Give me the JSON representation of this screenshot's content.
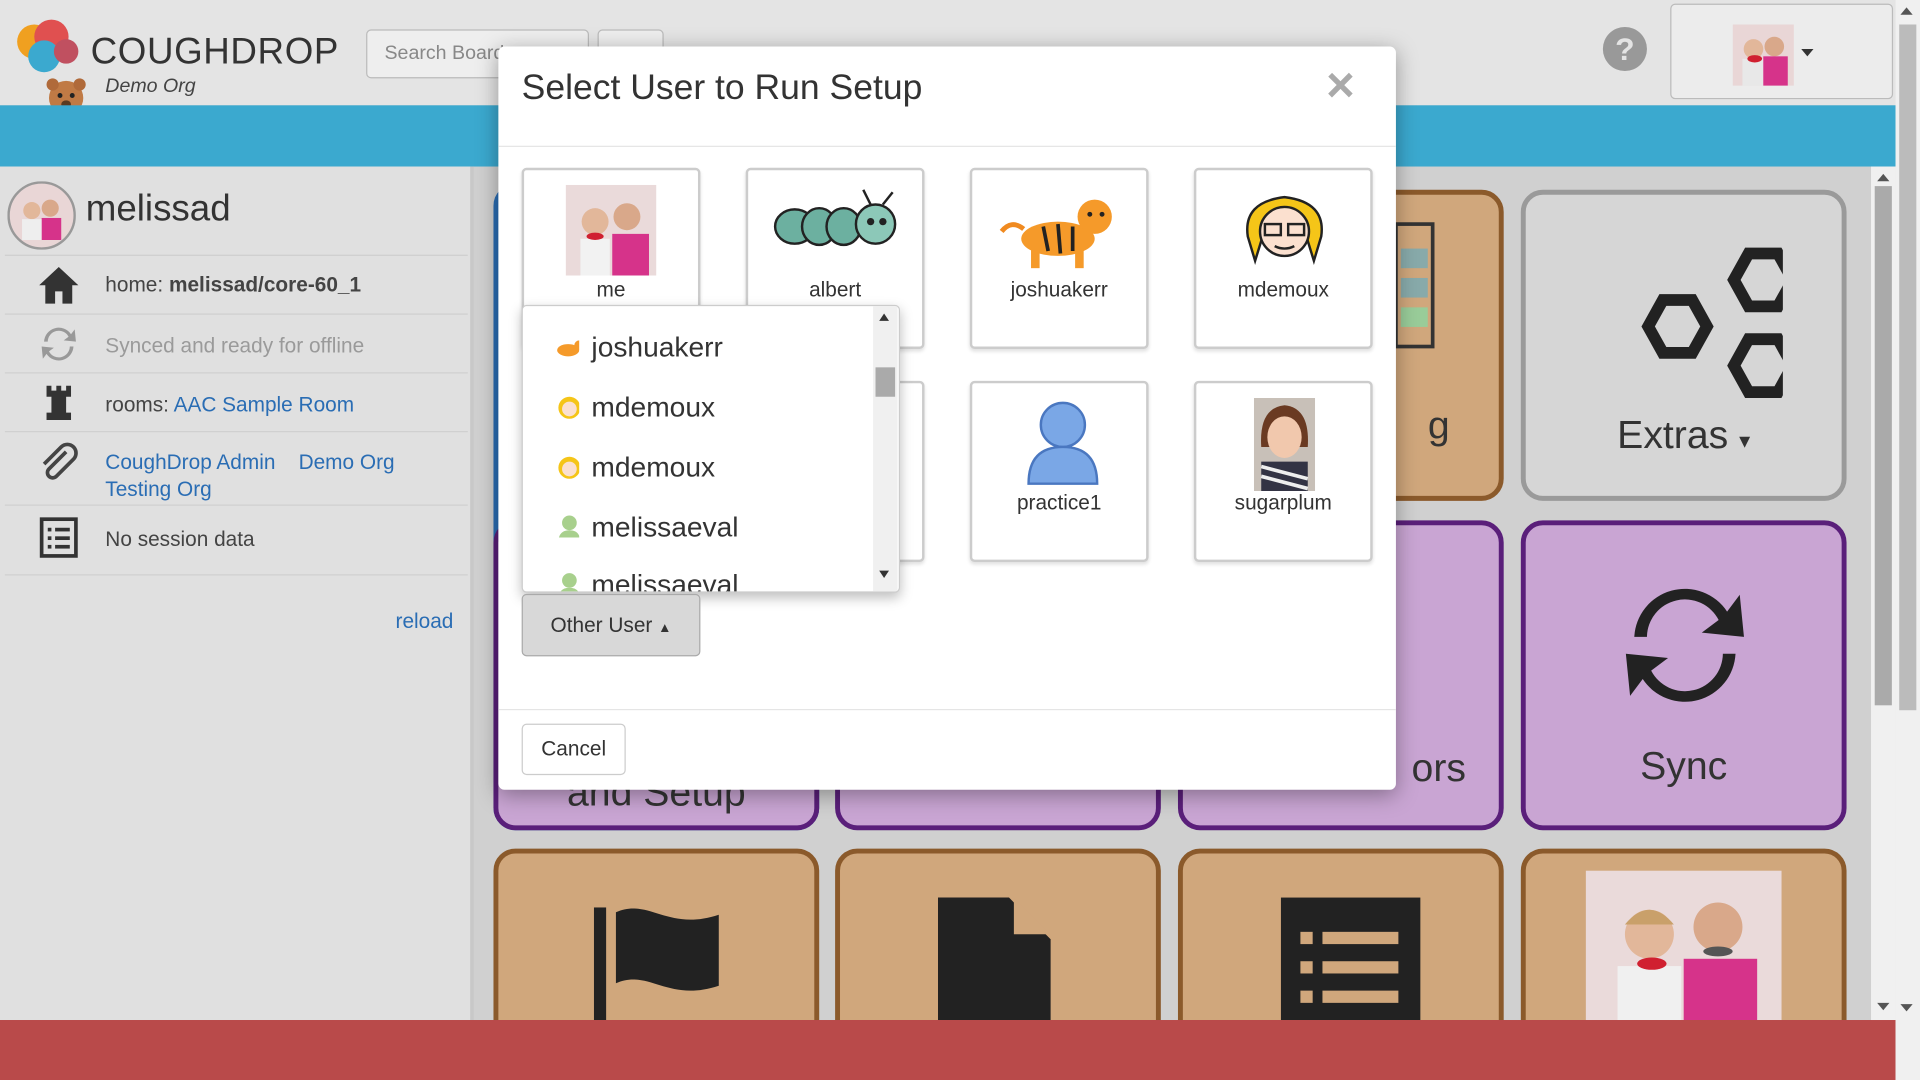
{
  "header": {
    "app_name": "COUGHDROP",
    "org": "Demo Org",
    "search_placeholder": "Search Boards",
    "help_label": "?"
  },
  "sidebar": {
    "username": "melissad",
    "home_prefix": "home:",
    "home_board": "melissad/core-60_1",
    "sync_status": "Synced and ready for offline",
    "rooms_prefix": "rooms:",
    "room": "AAC Sample Room",
    "orgs": [
      "CoughDrop Admin",
      "Demo Org",
      "Testing Org"
    ],
    "session": "No session data",
    "reload": "reload"
  },
  "board": {
    "tiles": [
      {
        "label": "g"
      },
      {
        "label": "Extras"
      },
      {
        "label": "and Setup"
      },
      {
        "label": "ors"
      },
      {
        "label": "Sync"
      }
    ]
  },
  "modal": {
    "title": "Select User to Run Setup",
    "close": "×",
    "users": [
      {
        "name": "me"
      },
      {
        "name": "albert"
      },
      {
        "name": "joshuakerr"
      },
      {
        "name": "mdemoux"
      },
      {
        "name": "practice1"
      },
      {
        "name": "sugarplum"
      }
    ],
    "dropdown": [
      "joshuakerr",
      "mdemoux",
      "mdemoux",
      "melissaeval",
      "melissaeval"
    ],
    "other_user": "Other User",
    "cancel": "Cancel"
  },
  "colors": {
    "accent_blue": "#3ba9cf",
    "footer_red": "#b94a4a",
    "tile_tan": "#d0a77c",
    "tile_purple": "#c9a5d3"
  }
}
